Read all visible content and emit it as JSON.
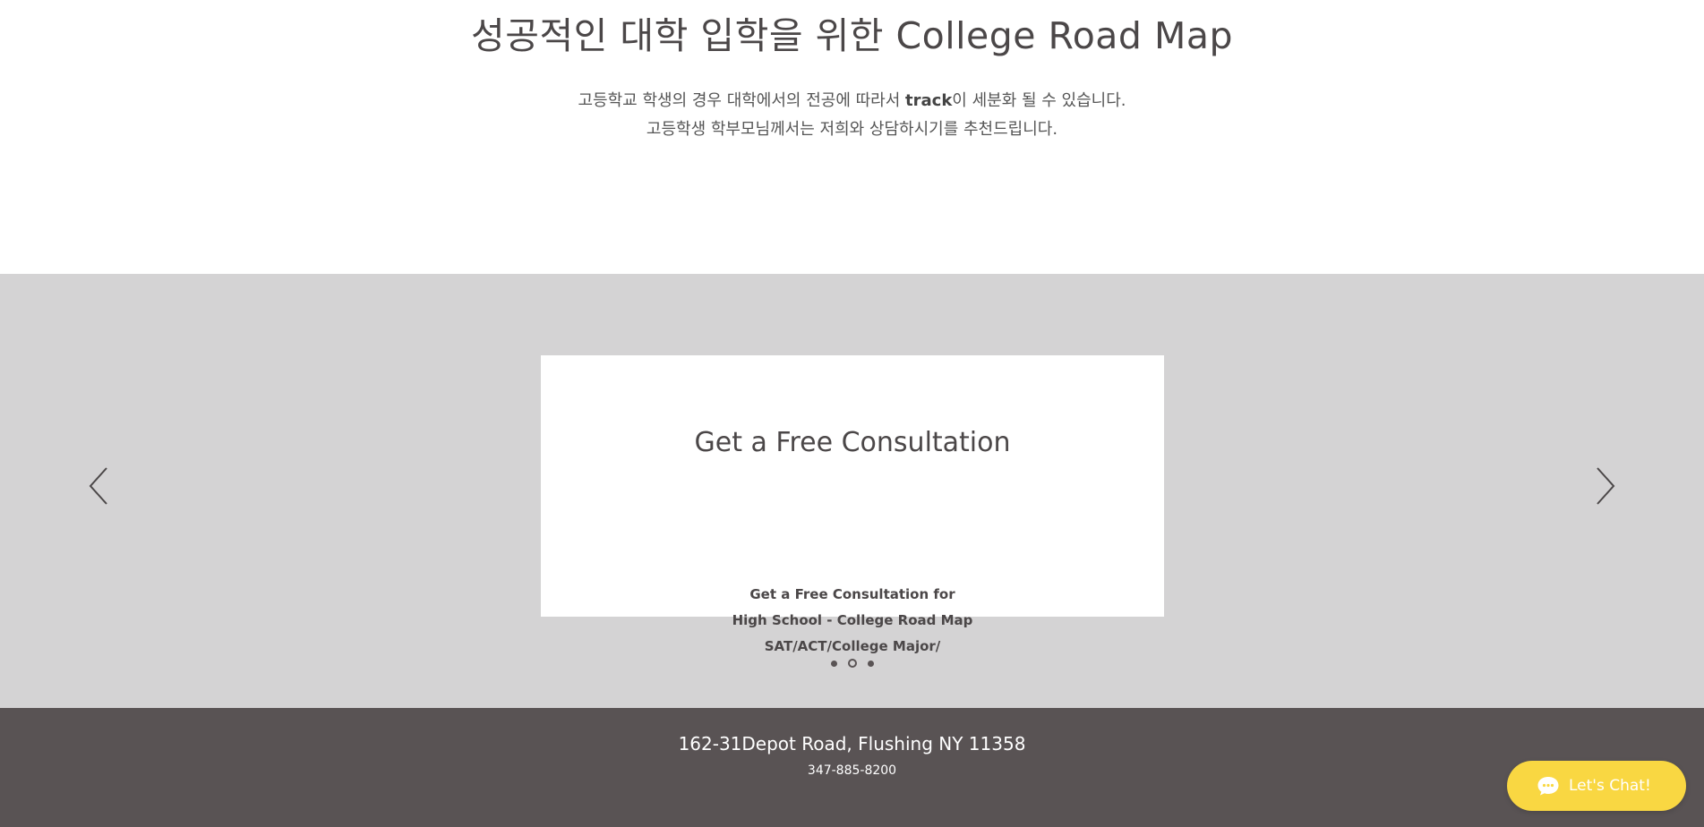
{
  "hero": {
    "title": "성공적인 대학 입학을 위한 College Road Map",
    "desc_line1_pre": "고등학교 학생의 경우 대학에서의 전공에 따라서 ",
    "desc_line1_bold": "track",
    "desc_line1_post": "이 세분화 될 수 있습니다.",
    "desc_line2": "고등학생 학부모님께서는 저희와 상담하시기를 추천드립니다."
  },
  "slider": {
    "card_title": "Get a Free Consultation",
    "card_lines": [
      "Get a Free Consultation for",
      "High School - College Road Map",
      "SAT/ACT/College Major/"
    ],
    "prev_icon": "chevron-left-icon",
    "next_icon": "chevron-right-icon",
    "dots_count": 3,
    "active_dot": 2
  },
  "footer": {
    "address": "162-31Depot Road, Flushing NY 11358",
    "phone": "347-885-8200"
  },
  "chat": {
    "label": "Let's Chat!",
    "icon": "chat-bubble-icon"
  },
  "colors": {
    "band": "#d4d3d4",
    "footer": "#595354",
    "chat": "#f9d742",
    "text": "#4b4748"
  }
}
